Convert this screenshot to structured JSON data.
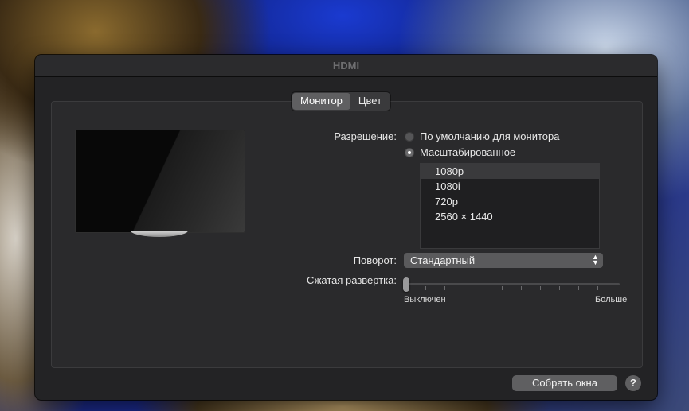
{
  "window": {
    "title": "HDMI"
  },
  "tabs": [
    {
      "label": "Монитор",
      "active": true
    },
    {
      "label": "Цвет",
      "active": false
    }
  ],
  "resolution": {
    "label": "Разрешение:",
    "options": [
      {
        "label": "По умолчанию для монитора",
        "checked": false
      },
      {
        "label": "Масштабированное",
        "checked": true
      }
    ],
    "list": [
      "1080p",
      "1080i",
      "720p",
      "2560 × 1440"
    ],
    "selected_index": 0
  },
  "rotation": {
    "label": "Поворот:",
    "value": "Стандартный"
  },
  "underscan": {
    "label": "Сжатая развертка:",
    "min_label": "Выключен",
    "max_label": "Больше",
    "value": 0
  },
  "footer": {
    "gather_button": "Собрать окна",
    "help": "?"
  }
}
